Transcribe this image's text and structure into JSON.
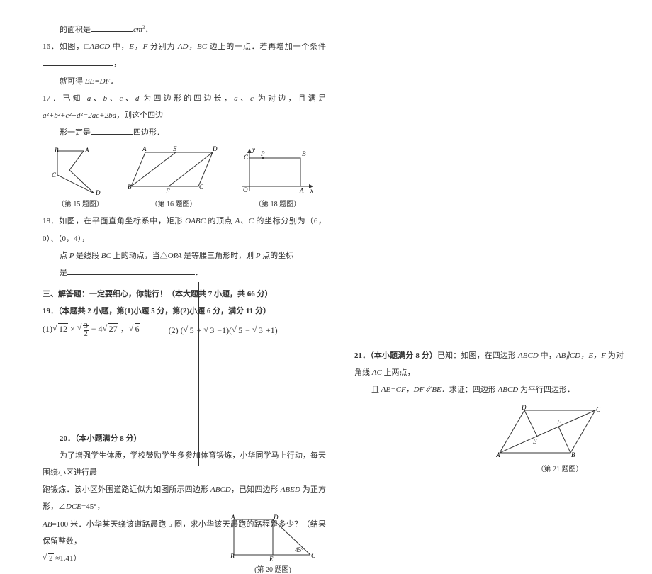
{
  "q15": {
    "tail": "的面积是",
    "unit": "cm"
  },
  "q16": {
    "line1_a": "16．如图，□",
    "line1_b": "ABCD ",
    "line1_c": "中，",
    "line1_d": "E，F ",
    "line1_e": "分别为 ",
    "line1_f": "AD，BC ",
    "line1_g": "边上的一点．若再增加一个条件",
    "line1_h": "，",
    "line2_a": "就可得 ",
    "line2_b": "BE=DF．"
  },
  "q17": {
    "line1_a": "17．已知 ",
    "line1_b": "a、b、c、d ",
    "line1_c": "为四边形的四边长，",
    "line1_d": "a、c ",
    "line1_e": "为对边，且满足 ",
    "line1_f": "a²+b²+c²+d²=2ac+2bd",
    "line1_g": "，则这个四边",
    "line2": "形一定是",
    "line2_b": "四边形．"
  },
  "diagrams": {
    "cap15": "（第 15 题图）",
    "cap16": "（第 16 题图）",
    "cap18": "（第 18 题图）"
  },
  "q18": {
    "line1_a": "18．如图，在平面直角坐标系中，矩形 ",
    "line1_b": "OABC ",
    "line1_c": "的顶点 ",
    "line1_d": "A、C ",
    "line1_e": "的坐标分别为（6，0）、（0，4），",
    "line2_a": "点 ",
    "line2_b": "P ",
    "line2_c": "是线段 ",
    "line2_d": "BC ",
    "line2_e": "上的动点，当△",
    "line2_f": "OPA ",
    "line2_g": "是等腰三角形时，则 ",
    "line2_h": "P ",
    "line2_i": "点的坐标",
    "line3_a": "是",
    "line3_b": "．"
  },
  "section3": "三、解答题：一定要细心，你能行！（本大题共 7 小题，共 66 分）",
  "q19": {
    "header": "19．（本题共 2 小题，第(1)小题 5 分，第(2)小题 6 分，满分 11 分）"
  },
  "q20": {
    "header": "20．（本小题满分 8 分）",
    "p1": "为了增强学生体质，学校鼓励学生多参加体育锻炼，小华同学马上行动，每天围绕小区进行晨",
    "p2_a": "跑锻炼．该小区外围道路近似为如图所示四边形 ",
    "p2_b": "ABCD",
    "p2_c": "，已知四边形 ",
    "p2_d": "ABED ",
    "p2_e": "为正方形，∠",
    "p2_f": "DCE",
    "p2_g": "=45°，",
    "p3_a": "AB",
    "p3_b": "=100 米．小华某天绕该道路晨跑 5 圈，求小华该天晨跑的路程是多少？（结果保留整数，",
    "p4": "≈1.41）",
    "cap": "(第 20 题图)"
  },
  "q21": {
    "header": "21．（本小题满分 8 分）",
    "body_a": "已知：如图，在四边形 ",
    "body_b": "ABCD ",
    "body_c": "中，",
    "body_d": "AB∥CD，E，F ",
    "body_e": "为对角线 ",
    "body_f": "AC ",
    "body_g": "上两点，",
    "line2_a": "且 ",
    "line2_b": "AE=CF，DF∥BE．",
    "line2_c": "求证：四边形 ",
    "line2_d": "ABCD ",
    "line2_e": "为平行四边形．",
    "cap": "（第 21 题图）"
  }
}
